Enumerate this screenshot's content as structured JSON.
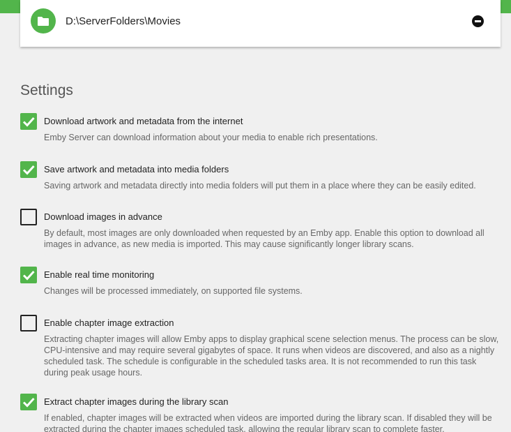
{
  "folder": {
    "path": "D:\\ServerFolders\\Movies"
  },
  "settings": {
    "title": "Settings",
    "items": [
      {
        "label": "Download artwork and metadata from the internet",
        "description": "Emby Server can download information about your media to enable rich presentations.",
        "checked": true
      },
      {
        "label": "Save artwork and metadata into media folders",
        "description": "Saving artwork and metadata directly into media folders will put them in a place where they can be easily edited.",
        "checked": true
      },
      {
        "label": "Download images in advance",
        "description": "By default, most images are only downloaded when requested by an Emby app. Enable this option to download all images in advance, as new media is imported. This may cause significantly longer library scans.",
        "checked": false
      },
      {
        "label": "Enable real time monitoring",
        "description": "Changes will be processed immediately, on supported file systems.",
        "checked": true
      },
      {
        "label": "Enable chapter image extraction",
        "description": "Extracting chapter images will allow Emby apps to display graphical scene selection menus. The process can be slow, CPU-intensive and may require several gigabytes of space. It runs when videos are discovered, and also as a nightly scheduled task. The schedule is configurable in the scheduled tasks area. It is not recommended to run this task during peak usage hours.",
        "checked": false
      },
      {
        "label": "Extract chapter images during the library scan",
        "description": "If enabled, chapter images will be extracted when videos are imported during the library scan. If disabled they will be extracted during the chapter images scheduled task, allowing the regular library scan to complete faster.",
        "checked": true
      }
    ]
  },
  "colors": {
    "accent": "#52b54b",
    "background": "#f0f0f0"
  },
  "icons": {
    "folder": "folder-icon",
    "remove": "remove-circle-icon",
    "check": "checkmark-icon"
  }
}
